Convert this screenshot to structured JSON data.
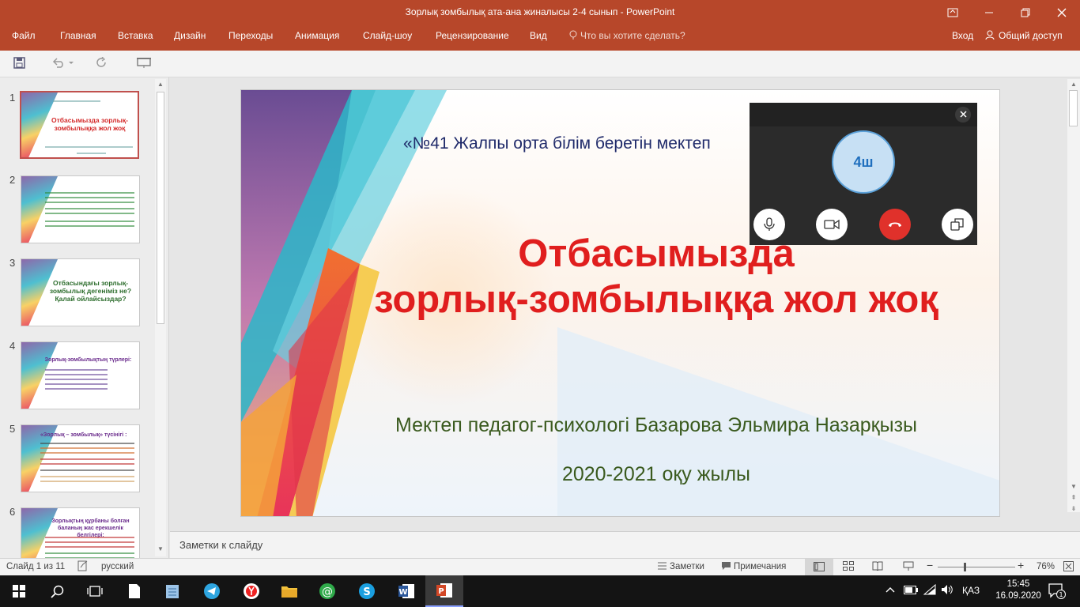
{
  "window": {
    "title": "Зорлық зомбылық ата-ана жиналысы 2-4 сынып - PowerPoint"
  },
  "ribbon": {
    "tabs": [
      "Файл",
      "Главная",
      "Вставка",
      "Дизайн",
      "Переходы",
      "Анимация",
      "Слайд-шоу",
      "Рецензирование",
      "Вид"
    ],
    "tell_me": "Что вы хотите сделать?",
    "sign_in": "Вход",
    "share": "Общий доступ"
  },
  "thumbnails": {
    "slides": [
      {
        "num": "1",
        "title": "Отбасымызда зорлық-зомбылыққа жол жоқ"
      },
      {
        "num": "2"
      },
      {
        "num": "3",
        "title": "Отбасындағы зорлық-зомбылық дегеніміз не? Қалай ойлайсыздар?"
      },
      {
        "num": "4",
        "title": "Зорлық-зомбылықтың түрлері:"
      },
      {
        "num": "5",
        "title": "«Зорлық – зомбылық» түсінігі :"
      },
      {
        "num": "6",
        "title": "Зорлықтың құрбаны болған баланың жас ерекшелік белгілері:"
      }
    ]
  },
  "slide": {
    "school": "«№41 Жалпы орта білім беретін мектеп",
    "title_line1": "Отбасымызда",
    "title_line2": "зорлық-зомбылыққа жол жоқ",
    "author": "Мектеп педагог-психологі Базарова Эльмира Назарқызы",
    "year": "2020-2021 оқу жылы"
  },
  "call": {
    "avatar_initials": "4ш",
    "colors": {
      "hangup": "#e0312b",
      "avatar_bg": "#c7e0f4"
    }
  },
  "notes": {
    "placeholder": "Заметки к слайду"
  },
  "status": {
    "slide_info": "Слайд 1 из 11",
    "language": "русский",
    "notes": "Заметки",
    "comments": "Примечания",
    "zoom": "76%"
  },
  "taskbar": {
    "lang": "ҚАЗ",
    "time": "15:45",
    "date": "16.09.2020",
    "notifications": "1"
  },
  "colors": {
    "accent": "#b7472a",
    "title_red": "#e01e1e",
    "author_green": "#3a5a1e"
  }
}
